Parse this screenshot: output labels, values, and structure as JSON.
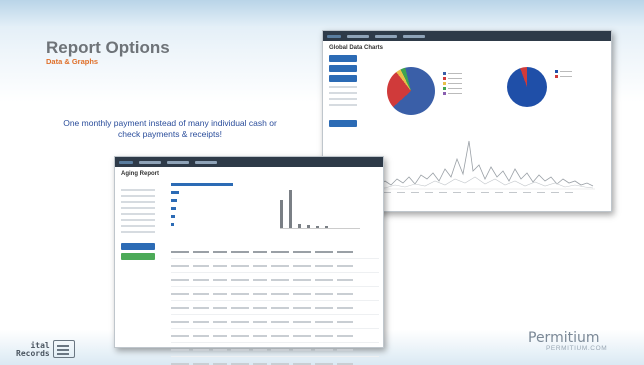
{
  "slide": {
    "title": "Report Options",
    "subtitle": "Data & Graphs",
    "bullet_text": "One monthly payment instead of many individual cash or check payments & receipts!"
  },
  "window_global_charts": {
    "heading": "Global Data Charts",
    "pie_colors": [
      "#3a5fa8",
      "#d03a3a",
      "#e8c04a",
      "#3fa44f"
    ]
  },
  "window_aging": {
    "heading": "Aging Report"
  },
  "logos": {
    "left_top": "ital",
    "left_bottom": "Records",
    "right_name": "Permitium",
    "right_url": "PERMITIUM.COM"
  },
  "colors": {
    "title": "#6e7378",
    "subtitle": "#e0702a",
    "bullet": "#2a4d9b",
    "accent_blue": "#2c6bb5"
  }
}
